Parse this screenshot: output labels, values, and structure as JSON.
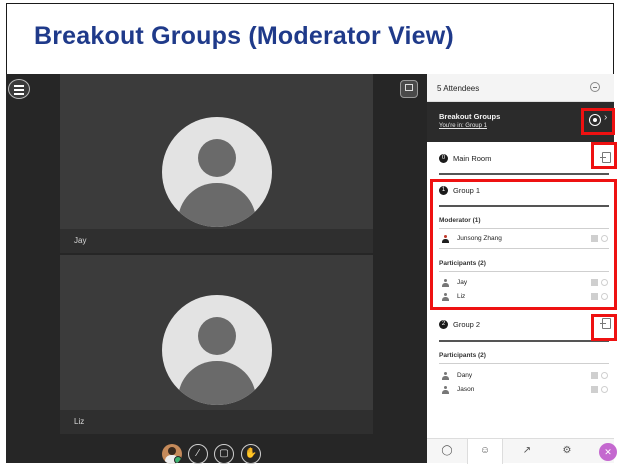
{
  "slide": {
    "title": "Breakout Groups (Moderator View)"
  },
  "video": {
    "tiles": [
      {
        "name": "Jay"
      },
      {
        "name": "Liz"
      }
    ]
  },
  "panel": {
    "attendees_title": "5 Attendees",
    "breakout": {
      "title": "Breakout Groups",
      "subtitle": "You're in: Group 1"
    },
    "main_room": {
      "number": "0",
      "label": "Main Room"
    },
    "group1": {
      "number": "1",
      "label": "Group 1",
      "moderator_header": "Moderator (1)",
      "moderator": "Junsong Zhang",
      "participants_header": "Participants (2)",
      "participants": [
        "Jay",
        "Liz"
      ]
    },
    "group2": {
      "number": "2",
      "label": "Group 2",
      "participants_header": "Participants (2)",
      "participants": [
        "Dany",
        "Jason"
      ]
    }
  },
  "colors": {
    "title": "#1f3a8a",
    "highlight": "#ee1111",
    "video_bg": "#262626",
    "collaborate_button": "#c468cf"
  },
  "icons": {
    "menu": "hamburger-icon",
    "layout": "layout-icon",
    "mic": "mic-muted-icon",
    "camera": "camera-off-icon",
    "hand": "raise-hand-icon",
    "chat": "chat-icon",
    "people": "people-icon",
    "share": "share-icon",
    "settings": "gear-icon"
  }
}
